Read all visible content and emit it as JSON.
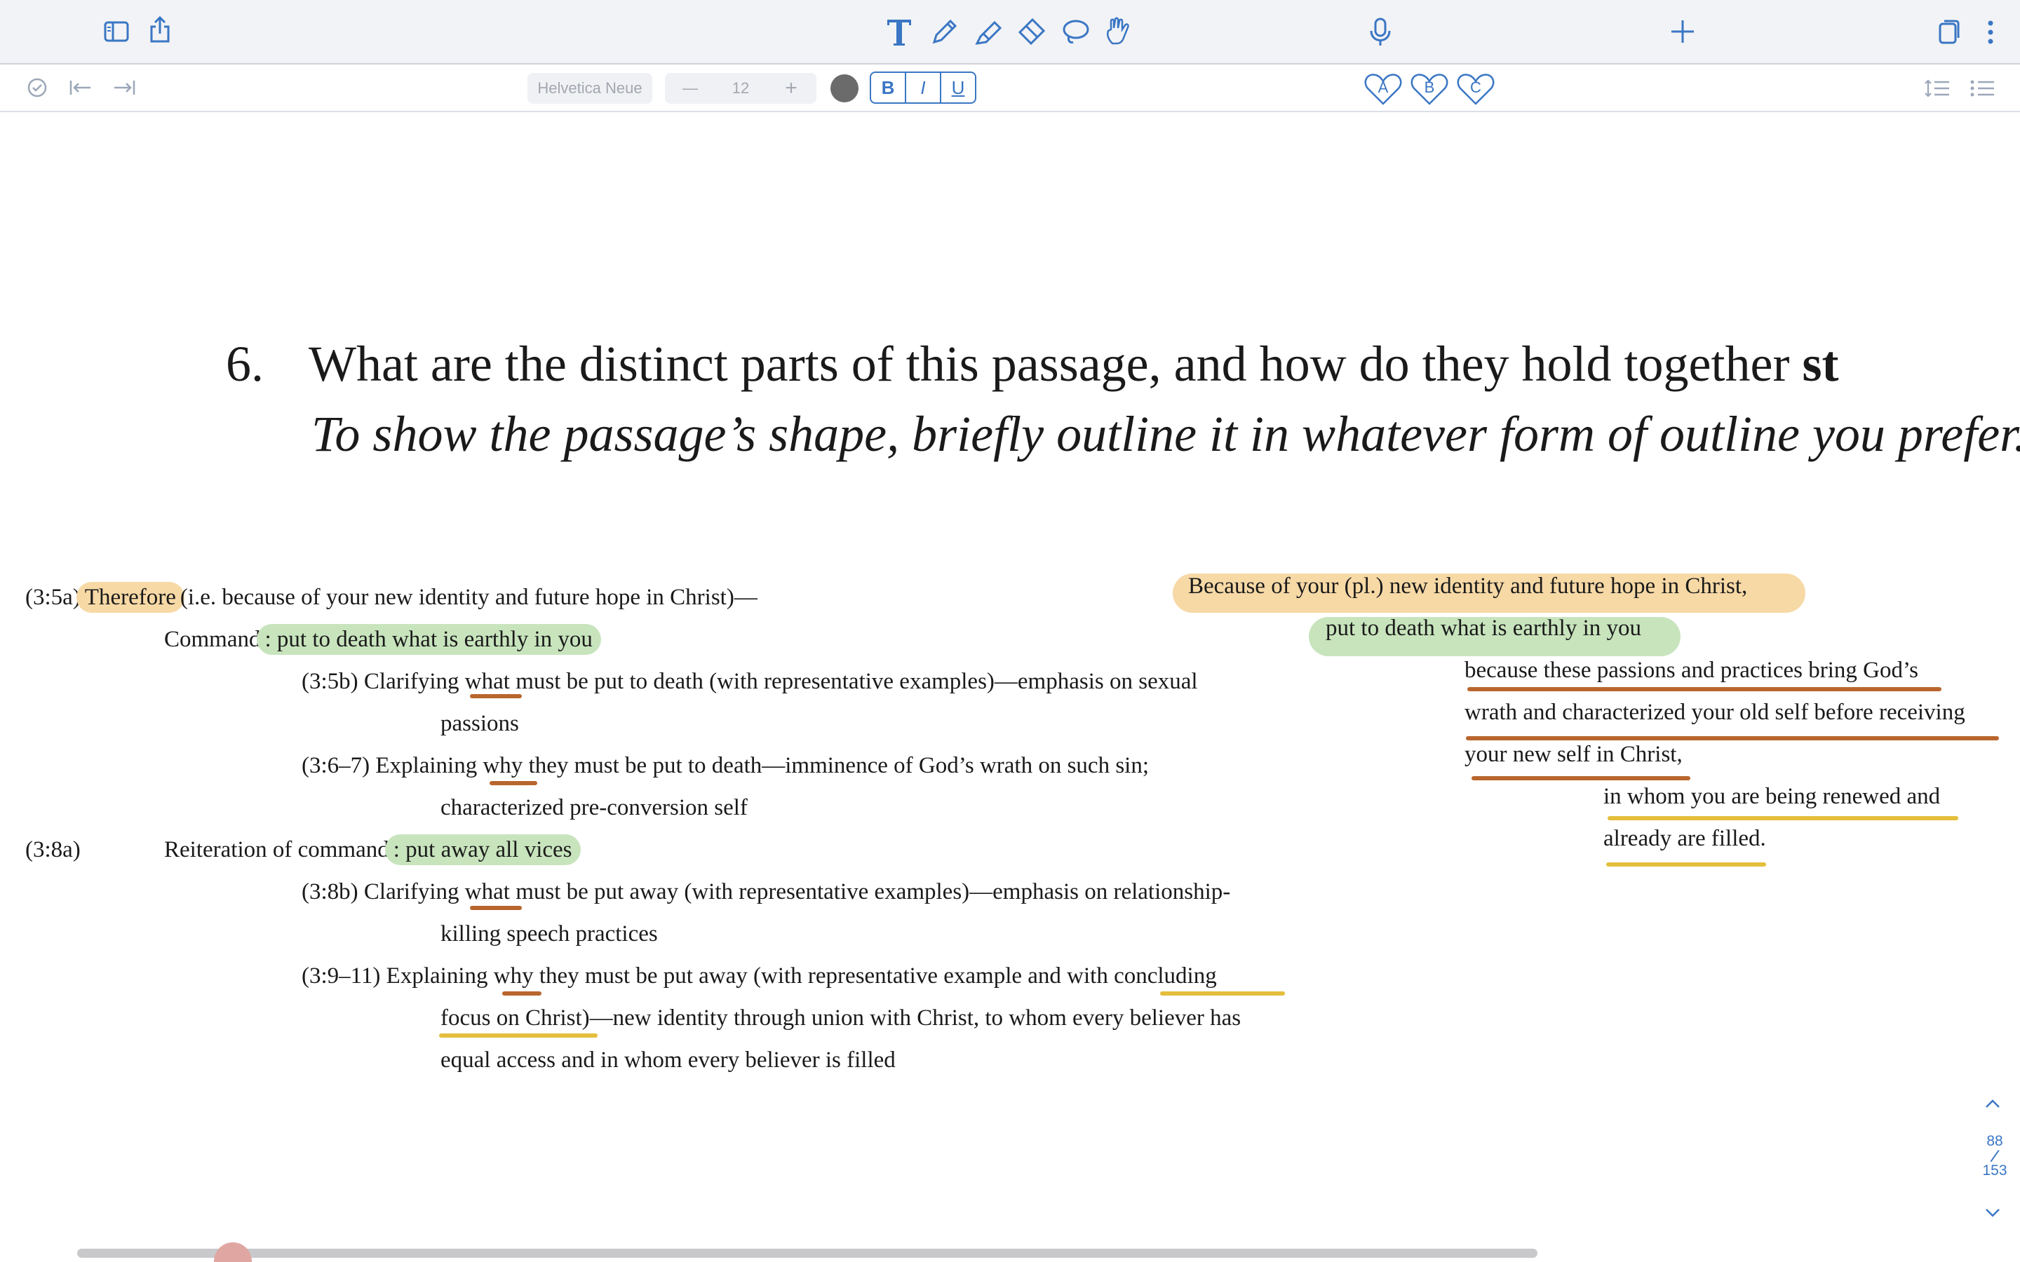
{
  "toolbar": {
    "left_icons": [
      "sidebar-icon",
      "share-icon"
    ],
    "tools": [
      "text-tool-icon",
      "pen-icon",
      "highlighter-icon",
      "eraser-icon",
      "lasso-icon",
      "hand-tool-icon"
    ],
    "right_icons": [
      "microphone-icon",
      "plus-icon",
      "pages-icon",
      "more-icon"
    ],
    "accent_color": "#3a76c4"
  },
  "format_bar": {
    "font_name": "Helvetica Neue",
    "font_size": "12",
    "decrease_label": "—",
    "increase_label": "+",
    "bold": "B",
    "italic": "I",
    "underline": "U",
    "style_a": "A",
    "style_b": "B",
    "style_c": "C"
  },
  "question": {
    "number": "6.",
    "line1": "What are the distinct parts of this passage, and how do they hold together",
    "line1_bold": "st",
    "line2": "To show the passage’s shape, briefly outline it in whatever form of outline you prefer."
  },
  "outline": {
    "l1_ref": "(3:5a)",
    "l1_hl": "Therefore",
    "l1_rest": "(i.e. because of your new identity and future hope in Christ)—",
    "l2_label": "Command",
    "l2_hl": ": put to death what is earthly in you",
    "l3a_pre": "(3:5b) Clarifying ",
    "l3a_word": "what",
    "l3a_post": " must be put to death (with representative examples)—emphasis on sexual",
    "l3b": "passions",
    "l4a_pre": "(3:6–7) Explaining ",
    "l4a_word": "why",
    "l4a_post": " they must be put to death—imminence of God’s wrath on such sin;",
    "l4b": "characterized  pre-conversion self",
    "l5_ref": "(3:8a)",
    "l5_label": "Reiteration of command",
    "l5_hl": ": put away all vices",
    "l6a_pre": "(3:8b) Clarifying ",
    "l6a_word": "what",
    "l6a_post": " must be put away  (with representative examples)—emphasis on relationship-",
    "l6b": "killing speech practices",
    "l7a_pre": "(3:9–11) Explaining ",
    "l7a_word": "why",
    "l7a_mid": " they must be put away (with representative example and with ",
    "l7a_tail": "concluding",
    "l7b_hl": "focus on Christ",
    "l7b_rest": ")—new identity through union with Christ, to whom every believer has",
    "l7c": "equal access and in whom every believer is filled"
  },
  "summary": {
    "s1": "Because of your (pl.) new identity and future hope in Christ,",
    "s2": "put to death what is earthly in you",
    "s3": "because these passions and practices bring God’s",
    "s4": "wrath and characterized your old self before receiving",
    "s5": "your new self in Christ,",
    "s6": "in whom you are being renewed and",
    "s7": "already are filled."
  },
  "pager": {
    "current": "88",
    "separator": "/",
    "total": "153"
  },
  "highlight_colors": {
    "orange": "#f7d9a6",
    "green": "#c8e4bd",
    "rust_underline": "#b8662e",
    "gold_underline": "#e4be3c"
  }
}
